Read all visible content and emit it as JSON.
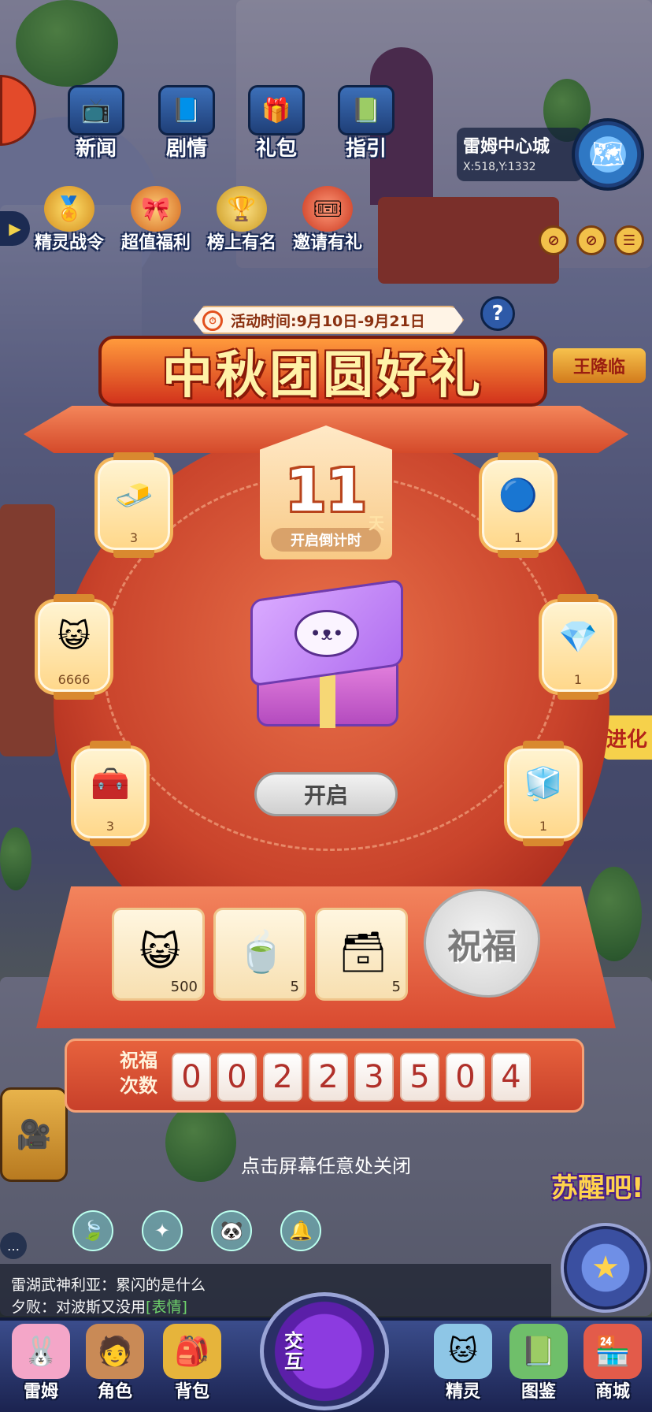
{
  "top_menu": [
    {
      "label": "新闻",
      "icon": "newspaper-icon",
      "glyph": "📺"
    },
    {
      "label": "剧情",
      "icon": "storybook-icon",
      "glyph": "📘"
    },
    {
      "label": "礼包",
      "icon": "gift-bag-icon",
      "glyph": "🎁"
    },
    {
      "label": "指引",
      "icon": "guide-book-icon",
      "glyph": "📗"
    }
  ],
  "second_menu": [
    {
      "label": "精灵战令",
      "icon": "battle-pass-icon",
      "glyph": "🏅"
    },
    {
      "label": "超值福利",
      "icon": "welfare-gift-icon",
      "glyph": "🎀"
    },
    {
      "label": "榜上有名",
      "icon": "trophy-icon",
      "glyph": "🏆"
    },
    {
      "label": "邀请有礼",
      "icon": "invite-ticket-icon",
      "glyph": "🎟"
    }
  ],
  "location": {
    "city": "雷姆中心城",
    "coords": "X:518,Y:1332"
  },
  "event": {
    "time_text": "活动时间:9月10日-9月21日",
    "title": "中秋团圆好礼",
    "side_banner": "王降临",
    "countdown_value": "11",
    "countdown_unit": "天",
    "countdown_label": "开启倒计时",
    "open_button": "开启",
    "bless_button": "祝福",
    "counter_label": "祝福次数",
    "counter_digits": [
      "0",
      "0",
      "2",
      "2",
      "3",
      "5",
      "0",
      "4"
    ]
  },
  "lanterns_left": [
    {
      "icon": "gold-block-icon",
      "glyph": "🧈",
      "count": "3"
    },
    {
      "icon": "yellow-cat-coin-icon",
      "glyph": "😺",
      "count": "6666"
    },
    {
      "icon": "red-treasure-chest-icon",
      "glyph": "🧰",
      "count": "3"
    }
  ],
  "lanterns_right": [
    {
      "icon": "blue-molecule-icon",
      "glyph": "🔵",
      "count": "1"
    },
    {
      "icon": "blue-crystal-icon",
      "glyph": "💎",
      "count": "1"
    },
    {
      "icon": "sugar-cubes-icon",
      "glyph": "🧊",
      "count": "1"
    }
  ],
  "rewards": [
    {
      "icon": "yellow-cat-coin-icon",
      "glyph": "😺",
      "count": "500"
    },
    {
      "icon": "tea-cup-icon",
      "glyph": "🍵",
      "count": "5"
    },
    {
      "icon": "green-chest-icon",
      "glyph": "🗃",
      "count": "5"
    }
  ],
  "close_hint": "点击屏幕任意处关闭",
  "side_labels": {
    "evolve": "进化",
    "awake": "苏醒吧!"
  },
  "chat": [
    {
      "speaker": "雷湖武神利亚",
      "text": "累闪的是什么",
      "emote": ""
    },
    {
      "speaker": "夕败",
      "text": "对波斯又没用",
      "emote": "[表情]"
    }
  ],
  "bottom_nav": [
    {
      "label": "雷姆",
      "icon": "pink-creature-icon",
      "glyph": "🐰"
    },
    {
      "label": "角色",
      "icon": "character-icon",
      "glyph": "🧑"
    },
    {
      "label": "背包",
      "icon": "backpack-icon",
      "glyph": "🎒"
    },
    {
      "label": "精灵",
      "icon": "spirit-icon",
      "glyph": "🐱"
    },
    {
      "label": "图鉴",
      "icon": "handbook-icon",
      "glyph": "📗"
    },
    {
      "label": "商城",
      "icon": "shop-icon",
      "glyph": "🏪"
    }
  ],
  "interact_label": "交互"
}
